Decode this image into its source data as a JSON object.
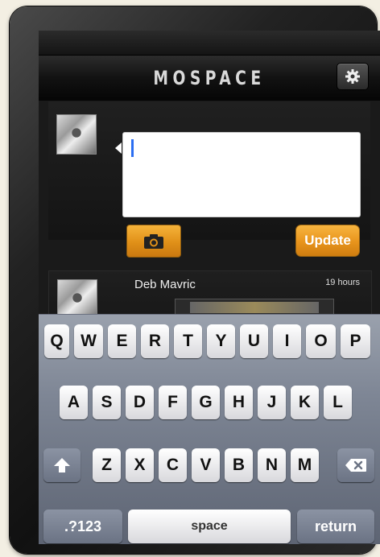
{
  "app": {
    "title": "MOSPACE"
  },
  "compose": {
    "input_value": "",
    "update_label": "Update"
  },
  "feed": [
    {
      "name": "Deb Mavric",
      "time": "19 hours"
    }
  ],
  "keyboard": {
    "row1": [
      "Q",
      "W",
      "E",
      "R",
      "T",
      "Y",
      "U",
      "I",
      "O",
      "P"
    ],
    "row2": [
      "A",
      "S",
      "D",
      "F",
      "G",
      "H",
      "J",
      "K",
      "L"
    ],
    "row3": [
      "Z",
      "X",
      "C",
      "V",
      "B",
      "N",
      "M"
    ],
    "numbers_label": ".?123",
    "space_label": "space",
    "return_label": "return"
  },
  "colors": {
    "accent": "#e8941c",
    "cursor": "#2b6ef2",
    "keyboard_bg": "#7e8695"
  },
  "icons": {
    "settings": "gear-icon",
    "camera": "camera-icon",
    "shift": "shift-arrow-icon",
    "delete": "backspace-icon"
  }
}
